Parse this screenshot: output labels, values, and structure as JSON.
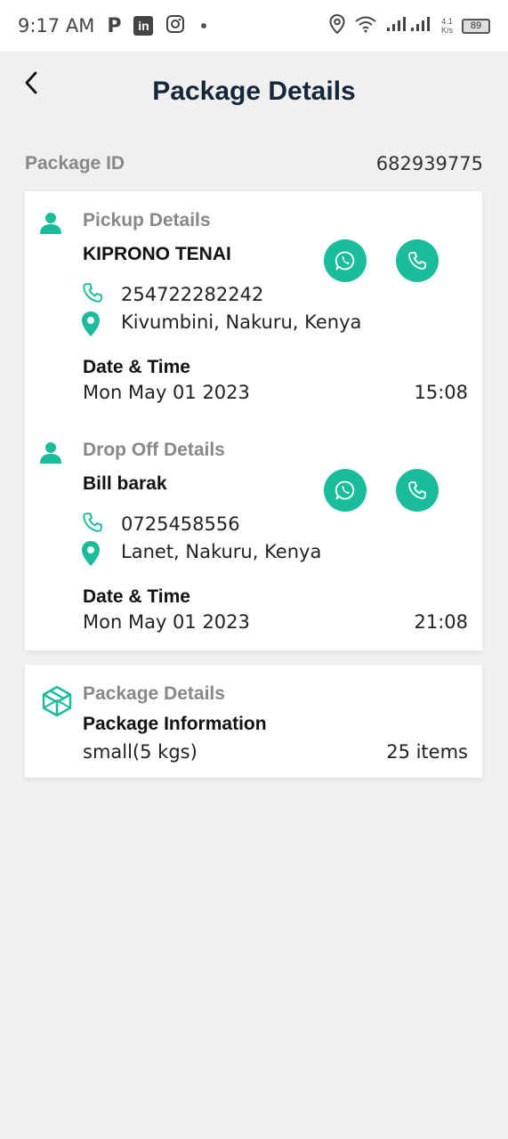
{
  "status_bar": {
    "time": "9:17 AM",
    "p_icon": "P",
    "linkedin_icon": "in",
    "speed_value": "4.1",
    "speed_unit": "K/s",
    "battery": "89"
  },
  "header": {
    "title": "Package Details",
    "back_icon": "chevron-left-icon"
  },
  "package_id": {
    "label": "Package ID",
    "value": "682939775"
  },
  "pickup": {
    "section_title": "Pickup Details",
    "name": "KIPRONO TENAI",
    "phone": "254722282242",
    "location": "Kivumbini, Nakuru, Kenya",
    "datetime_label": "Date & Time",
    "date": "Mon May 01 2023",
    "time": "15:08"
  },
  "dropoff": {
    "section_title": "Drop Off Details",
    "name": "Bill barak",
    "phone": "0725458556",
    "location": "Lanet, Nakuru, Kenya",
    "datetime_label": "Date & Time",
    "date": "Mon May 01 2023",
    "time": "21:08"
  },
  "package": {
    "section_title": "Package Details",
    "info_label": "Package Information",
    "size": "small(5 kgs)",
    "items": "25 items"
  },
  "colors": {
    "accent": "#1abc9c",
    "title": "#14263a",
    "muted": "#888888",
    "background": "#f0f0f0"
  }
}
